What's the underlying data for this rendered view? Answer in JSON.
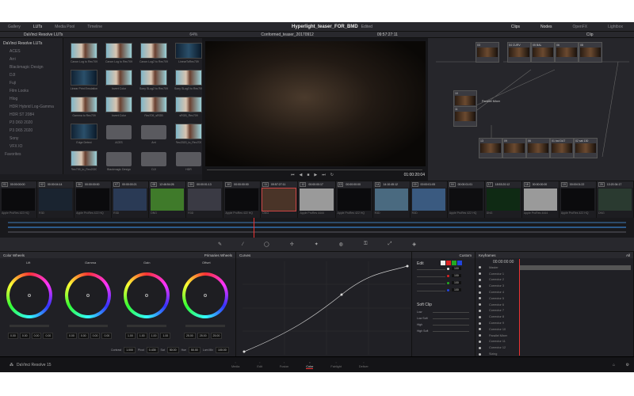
{
  "topbar": {
    "tabs": [
      "Gallery",
      "LUTs",
      "Media Pool",
      "Timeline"
    ],
    "active": "LUTs",
    "project_title": "Hyperlight_teaser_FOR_BMD",
    "status": "Edited",
    "right": [
      "Clips",
      "Nodes",
      "OpenFX",
      "Lightbox"
    ]
  },
  "subbar": {
    "lut_header": "DaVinci Resolve LUTs",
    "zoom": "64%",
    "timeline_name": "Conformed_teaser_20170912",
    "timecode": "09:57:27:11",
    "clip_mode": "Clip"
  },
  "lut_tree": {
    "root": "DaVinci Resolve LUTs",
    "items": [
      "ACES",
      "Arri",
      "Blackmagic Design",
      "DJI",
      "Fuji",
      "Film Looks",
      "Hlog",
      "HDR Hybrid Log-Gamma",
      "HDR ST 2084",
      "P3 D60 2020",
      "P3 D65 2020",
      "Sony",
      "VFX IO"
    ],
    "favorites": "Favorites"
  },
  "lut_grid": [
    {
      "label": "Canon Log to Rec709",
      "type": "lut"
    },
    {
      "label": "Canon Log to Rec709",
      "type": "lut"
    },
    {
      "label": "Canon Log2 to Rec709",
      "type": "lut"
    },
    {
      "label": "LinearToRec709",
      "type": "dark"
    },
    {
      "label": "Linear Print Emulation",
      "type": "dark"
    },
    {
      "label": "Invert Color",
      "type": "lut"
    },
    {
      "label": "Sony SLog2 to Rec709",
      "type": "lut"
    },
    {
      "label": "Sony SLog3 to Rec709",
      "type": "lut"
    },
    {
      "label": "Gamma to Rec709",
      "type": "lut"
    },
    {
      "label": "Invert Color",
      "type": "lut"
    },
    {
      "label": "Rec709_sRGB",
      "type": "lut"
    },
    {
      "label": "sRGB_Rec709",
      "type": "lut"
    },
    {
      "label": "Edge Detect",
      "type": "dark"
    },
    {
      "label": "ACES",
      "type": "folder"
    },
    {
      "label": "Arri",
      "type": "folder"
    },
    {
      "label": "Rec2020_to_Rec709",
      "type": "lut"
    },
    {
      "label": "Rec709_to_Rec2020",
      "type": "lut"
    },
    {
      "label": "Blackmagic Design",
      "type": "folder"
    },
    {
      "label": "DJI",
      "type": "folder"
    },
    {
      "label": "HDR",
      "type": "folder"
    }
  ],
  "viewer": {
    "timecode": "01:00:20:04"
  },
  "nodes": [
    {
      "label": "03"
    },
    {
      "label": "04 CURV"
    },
    {
      "label": "05 BAL"
    },
    {
      "label": "06"
    },
    {
      "label": "08"
    },
    {
      "label": "10"
    },
    {
      "label": "11"
    },
    {
      "label": "Parallel Mixer"
    },
    {
      "label": "13"
    },
    {
      "label": "09"
    },
    {
      "label": "06"
    },
    {
      "label": "01 bal DAT"
    },
    {
      "label": "02 sat 130"
    }
  ],
  "clips": [
    {
      "n": "01",
      "tc": "00:00:00:00",
      "codec": "Apple ProRes 422 HQ",
      "c": "#0b0b0d"
    },
    {
      "n": "02",
      "tc": "00:00:04:14",
      "codec": "R3D",
      "c": "#1a2430"
    },
    {
      "n": "06",
      "tc": "00:00:00:00",
      "codec": "Apple ProRes 422 HQ",
      "c": "#0b0b0d"
    },
    {
      "n": "07",
      "tc": "00:00:00:21",
      "codec": "R3D",
      "c": "#2a3a55"
    },
    {
      "n": "08",
      "tc": "12:46:54:26",
      "codec": "DNG",
      "c": "#3f7a2a"
    },
    {
      "n": "09",
      "tc": "00:00:01:13",
      "codec": "R3D",
      "c": "#3a3a44"
    },
    {
      "n": "10",
      "tc": "00:00:00:00",
      "codec": "Apple ProRes 422 HQ",
      "c": "#0b0b0d"
    },
    {
      "n": "11",
      "tc": "09:57:27:11",
      "codec": "DNG",
      "c": "#4a3428",
      "sel": true
    },
    {
      "n": "12",
      "tc": "00:00:00:17",
      "codec": "Apple ProRes 4444",
      "c": "#9a9a9a"
    },
    {
      "n": "13",
      "tc": "00:00:00:00",
      "codec": "Apple ProRes 422 HQ",
      "c": "#0b0b0d"
    },
    {
      "n": "14",
      "tc": "14:10:45:12",
      "codec": "R3D",
      "c": "#4a6a80"
    },
    {
      "n": "15",
      "tc": "00:00:01:05",
      "codec": "R3D",
      "c": "#3a5a80"
    },
    {
      "n": "16",
      "tc": "00:00:01:01",
      "codec": "Apple ProRes 422 HQ",
      "c": "#0e0e10"
    },
    {
      "n": "17",
      "tc": "18:53:20:12",
      "codec": "DNG",
      "c": "#0f2a14"
    },
    {
      "n": "18",
      "tc": "00:00:00:00",
      "codec": "Apple ProRes 4444",
      "c": "#9a9a9a"
    },
    {
      "n": "19",
      "tc": "00:00:01:22",
      "codec": "Apple ProRes 422 HQ",
      "c": "#0b0b0d"
    },
    {
      "n": "20",
      "tc": "13:20:34:17",
      "codec": "DNG",
      "c": "#2a3a30"
    }
  ],
  "color_wheels": {
    "title": "Color Wheels",
    "mode": "Primaries Wheels",
    "wheels": [
      {
        "name": "Lift",
        "values": [
          "0.00",
          "0.00",
          "0.00",
          "0.00"
        ]
      },
      {
        "name": "Gamma",
        "values": [
          "0.00",
          "0.00",
          "0.00",
          "0.00"
        ]
      },
      {
        "name": "Gain",
        "values": [
          "1.00",
          "1.00",
          "1.00",
          "1.00"
        ]
      },
      {
        "name": "Offset",
        "values": [
          "25.00",
          "25.00",
          "25.00"
        ]
      }
    ],
    "channels": [
      "Y",
      "R",
      "G",
      "B"
    ],
    "params": [
      {
        "label": "Contrast",
        "value": "1.000"
      },
      {
        "label": "Pivot",
        "value": "0.435"
      },
      {
        "label": "Sat",
        "value": "50.00"
      },
      {
        "label": "Hue",
        "value": "50.00"
      },
      {
        "label": "Lum Mix",
        "value": "100.00"
      }
    ]
  },
  "curves": {
    "title": "Curves"
  },
  "custom": {
    "title": "Custom",
    "edit": "Edit",
    "values": [
      "100",
      "100",
      "100",
      "100"
    ],
    "soft_clip": "Soft Clip",
    "soft_labels": [
      "Low",
      "Low Soft",
      "High",
      "High Soft"
    ]
  },
  "keyframes": {
    "title": "Keyframes",
    "filter": "All",
    "timecode": "00:00:00:00",
    "rows": [
      "Master",
      "Corrector 1",
      "Corrector 2",
      "Corrector 3",
      "Corrector 4",
      "Corrector 5",
      "Corrector 6",
      "Corrector 7",
      "Corrector 8",
      "Corrector 9",
      "Corrector 10",
      "Parallel Mixer",
      "Corrector 11",
      "Corrector 12",
      "Sizing"
    ]
  },
  "bottom_nav": {
    "brand": "DaVinci Resolve 15",
    "pages": [
      "Media",
      "Edit",
      "Fusion",
      "Color",
      "Fairlight",
      "Deliver"
    ],
    "active": "Color"
  },
  "colors": {
    "accent": "#e33b3b",
    "bg": "#1c1c20"
  }
}
